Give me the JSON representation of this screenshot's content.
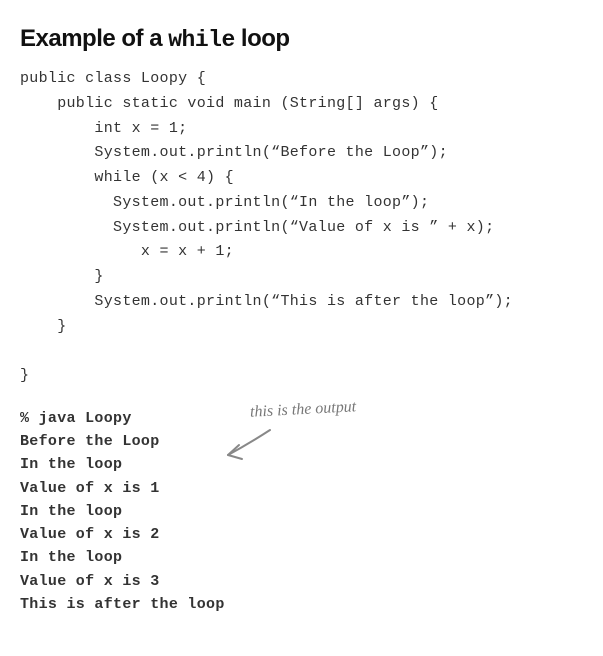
{
  "title_prefix": "Example of a ",
  "title_keyword": "while",
  "title_suffix": " loop",
  "code_lines": [
    "public class Loopy {",
    "    public static void main (String[] args) {",
    "        int x = 1;",
    "        System.out.println(“Before the Loop”);",
    "        while (x < 4) {",
    "          System.out.println(“In the loop”);",
    "          System.out.println(“Value of x is ” + x);",
    "             x = x + 1;",
    "        }",
    "        System.out.println(“This is after the loop”);",
    "    }",
    "",
    "}"
  ],
  "output_lines": [
    "% java Loopy",
    "Before the Loop",
    "In the loop",
    "Value of x is 1",
    "In the loop",
    "Value of x is 2",
    "In the loop",
    "Value of x is 3",
    "This is after the loop"
  ],
  "annotation_text": "this is the output"
}
